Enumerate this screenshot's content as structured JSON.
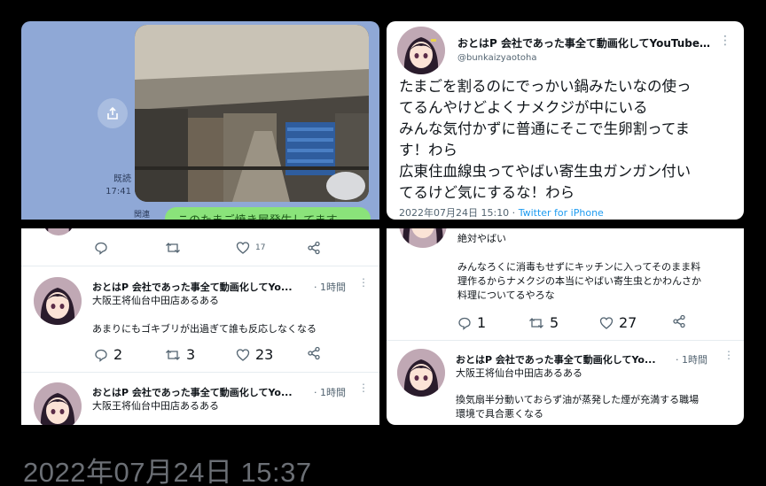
{
  "chat": {
    "read_label": "既読",
    "time": "17:41",
    "bubble_text": "このたまご焼き屋発生してます",
    "bubble_left_label": "関連"
  },
  "main_tweet": {
    "name": "おとはP 会社であった事全て動画化してYouTube…",
    "handle": "@bunkaizyaotoha",
    "lines": [
      "たまごを割るのにでっかい鍋みたいなの使っ",
      "てるんやけどよくナメクジが中にいる",
      "みんな気付かずに普通にそこで生卵割ってま",
      "す！わら",
      "広東住血線虫ってやばい寄生虫ガンガン付い",
      "てるけど気にするな！わら"
    ],
    "date": "2022年07月24日 15:10 ·",
    "via": "Twitter for iPhone"
  },
  "left_panel": {
    "top_actions": {
      "reply": "",
      "retweet": "",
      "like": "17"
    },
    "reply1": {
      "name": "おとはP 会社であった事全て動画化してYo...",
      "time": "· 1時間",
      "text1": "大阪王将仙台中田店あるある",
      "text2": "あまりにもゴキブリが出過ぎて誰も反応しなくなる",
      "reply_count": "2",
      "retweet_count": "3",
      "like_count": "23"
    },
    "reply2": {
      "name": "おとはP 会社であった事全て動画化してYo...",
      "time": "· 1時間",
      "text1": "大阪王将仙台中田店あるある"
    }
  },
  "right_panel": {
    "top_text": "絶対やばい",
    "text_lines": [
      "みんなろくに消毒もせずにキッチンに入ってそのまま料",
      "理作るからナメクジの本当にやばい寄生虫とかわんさか",
      "料理についてるやろな"
    ],
    "reply_count": "1",
    "retweet_count": "5",
    "like_count": "27",
    "reply": {
      "name": "おとはP 会社であった事全て動画化してYo...",
      "time": "· 1時間",
      "text1": "大阪王将仙台中田店あるある",
      "text2": "換気扇半分動いておらず油が蒸発した煙が充満する職場",
      "text3": "環境で具合悪くなる"
    }
  },
  "timestamp": "2022年07月24日 15:37",
  "colors": {
    "link": "#1d9bf0",
    "chat_bg": "#8fa8d6",
    "bubble": "#8ae37a"
  }
}
